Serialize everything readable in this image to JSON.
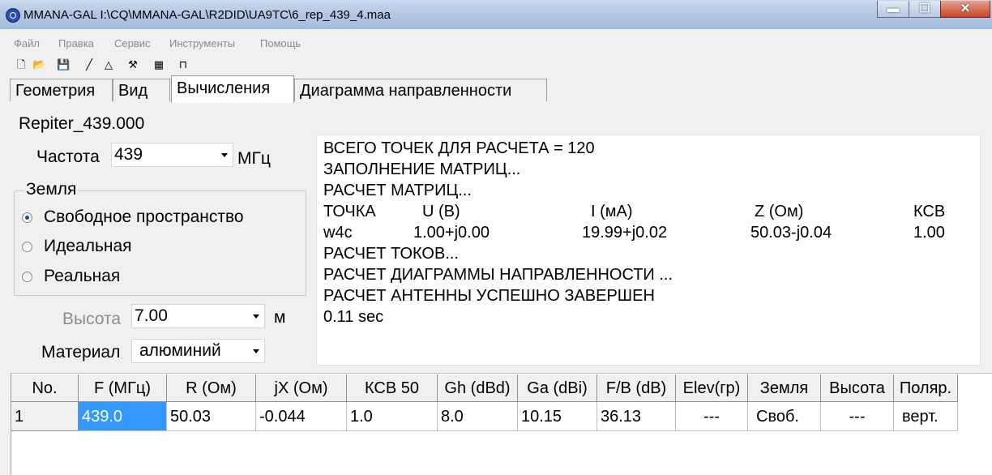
{
  "window": {
    "title": "MMANA-GAL I:\\CQ\\MMANA-GAL\\R2DID\\UA9TC\\6_rep_439_4.maa",
    "controls": {
      "minimize": "▬",
      "maximize": "☐",
      "close": "✕"
    },
    "title_icon": "app-globe-icon"
  },
  "menu": [
    "Файл",
    "Правка",
    "Сервис",
    "Инструменты",
    "Помощь"
  ],
  "toolbar": [
    {
      "name": "new-file-icon",
      "glyph": "🗋"
    },
    {
      "name": "open-folder-icon",
      "glyph": "📂"
    },
    {
      "name": "save-disk-icon",
      "glyph": "💾"
    },
    {
      "name": "line-tool-icon",
      "glyph": "╱"
    },
    {
      "name": "triangle-tool-icon",
      "glyph": "△"
    },
    {
      "name": "tools-icon",
      "glyph": "⚒"
    },
    {
      "name": "calculator-icon",
      "glyph": "▦"
    },
    {
      "name": "antenna-icon",
      "glyph": "⊓"
    }
  ],
  "tabs": [
    "Геометрия",
    "Вид",
    "Вычисления",
    "Диаграмма направленности"
  ],
  "active_tab": "Вычисления",
  "model_name": "Repiter_439.000",
  "frequency": {
    "label": "Частота",
    "value": "439",
    "unit": "МГц"
  },
  "ground": {
    "title": "Земля",
    "options": [
      "Свободное пространство",
      "Идеальная",
      "Реальная"
    ],
    "selected": "Свободное пространство"
  },
  "height": {
    "label": "Высота",
    "value": "7.00",
    "unit": "м"
  },
  "material": {
    "label": "Материал",
    "value": "алюминий"
  },
  "output": {
    "lines": [
      "ВСЕГО ТОЧЕК ДЛЯ РАСЧЕТА = 120",
      "ЗАПОЛНЕНИЕ МАТРИЦ...",
      "РАСЧЕТ МАТРИЦ..."
    ],
    "table_header": [
      "ТОЧКА",
      "U (В)",
      "I (мА)",
      "Z (Ом)",
      "КСВ"
    ],
    "table_row": [
      "w4c",
      "1.00+j0.00",
      "19.99+j0.02",
      "50.03-j0.04",
      "1.00"
    ],
    "lines_after": [
      "РАСЧЕТ ТОКОВ...",
      "РАСЧЕТ ДИАГРАММЫ НАПРАВЛЕННОСТИ ...",
      "РАСЧЕТ АНТЕННЫ УСПЕШНО ЗАВЕРШЕН",
      "0.11 sec"
    ]
  },
  "results": {
    "columns": [
      "No.",
      "F (МГц)",
      "R (Ом)",
      "jX (Ом)",
      "КСВ 50",
      "Gh (dBd)",
      "Ga (dBi)",
      "F/B (dB)",
      "Elev(гр)",
      "Земля",
      "Высота",
      "Поляр."
    ],
    "rows": [
      [
        "1",
        "439.0",
        "50.03",
        "-0.044",
        "1.0",
        "8.0",
        "10.15",
        "36.13",
        "---",
        "Своб.",
        "---",
        "верт."
      ]
    ]
  }
}
